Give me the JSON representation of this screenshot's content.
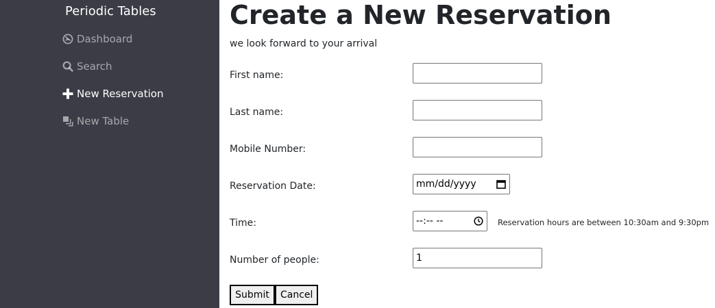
{
  "sidebar": {
    "brand": "Periodic Tables",
    "items": [
      {
        "label": "Dashboard",
        "icon": "dashboard-icon"
      },
      {
        "label": "Search",
        "icon": "search-icon"
      },
      {
        "label": "New Reservation",
        "icon": "plus-icon",
        "active": true
      },
      {
        "label": "New Table",
        "icon": "layers-icon"
      }
    ],
    "colors": {
      "background": "#3b3c45",
      "active_text": "#ffffff",
      "inactive_text": "#a4a5a9"
    }
  },
  "main": {
    "title": "Create a New Reservation",
    "subtitle": "we look forward to your arrival",
    "form": {
      "first_name": {
        "label": "First name:",
        "value": ""
      },
      "last_name": {
        "label": "Last name:",
        "value": ""
      },
      "mobile_number": {
        "label": "Mobile Number:",
        "value": ""
      },
      "reservation_date": {
        "label": "Reservation Date:",
        "placeholder": "mm/dd/yyyy",
        "icon": "calendar-icon"
      },
      "time": {
        "label": "Time:",
        "placeholder": "--:-- --",
        "icon": "clock-icon",
        "hint": "Reservation hours are between 10:30am and 9:30pm"
      },
      "people": {
        "label": "Number of people:",
        "value": "1"
      }
    },
    "buttons": {
      "submit": "Submit",
      "cancel": "Cancel"
    }
  }
}
